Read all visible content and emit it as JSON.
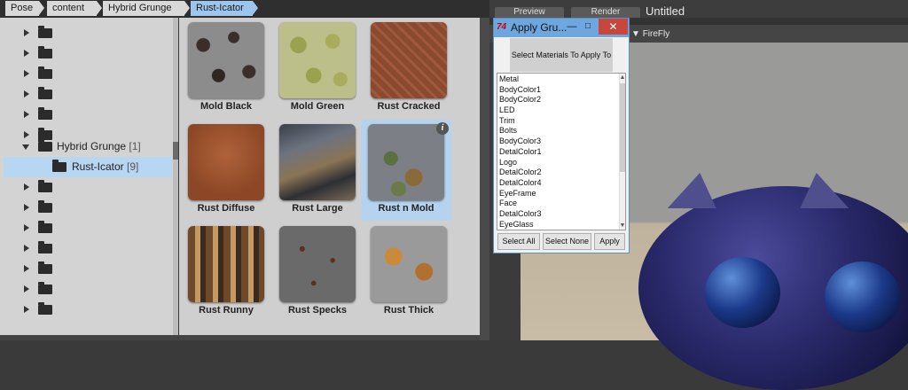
{
  "breadcrumb": [
    "Pose",
    "content",
    "Hybrid Grunge",
    "Rust-Icator"
  ],
  "tree": {
    "expanded_item": {
      "label": "Hybrid Grunge",
      "count": "[1]"
    },
    "selected_item": {
      "label": "Rust-Icator",
      "count": "[9]"
    }
  },
  "thumbnails": [
    {
      "name": "Mold Black"
    },
    {
      "name": "Mold Green"
    },
    {
      "name": "Rust Cracked"
    },
    {
      "name": "Rust Diffuse"
    },
    {
      "name": "Rust Large"
    },
    {
      "name": "Rust n Mold",
      "selected": true
    },
    {
      "name": "Rust Runny"
    },
    {
      "name": "Rust Specks"
    },
    {
      "name": "Rust Thick"
    }
  ],
  "info_badge": "i",
  "right_panel": {
    "tabs": [
      "Preview",
      "Render"
    ],
    "document_title": "Untitled",
    "renderer": "FireFly"
  },
  "dialog": {
    "icon": "74",
    "title": "Apply Gru...",
    "header": "Select Materials To Apply To",
    "materials": [
      "Metal",
      "BodyColor1",
      "BodyColor2",
      "LED",
      "Trim",
      "Bolts",
      "BodyColor3",
      "DetalColor1",
      "Logo",
      "DetalColor2",
      "DetalColor4",
      "EyeFrame",
      "Face",
      "DetalColor3",
      "EyeGlass"
    ],
    "buttons": {
      "select_all": "Select All",
      "select_none": "Select None",
      "apply": "Apply"
    },
    "controls": {
      "minimize": "—",
      "maximize": "□",
      "close": "✕"
    }
  },
  "colors": {
    "selection": "#b5d3ef",
    "titlebar": "#6ea7de",
    "close": "#c9463d"
  }
}
